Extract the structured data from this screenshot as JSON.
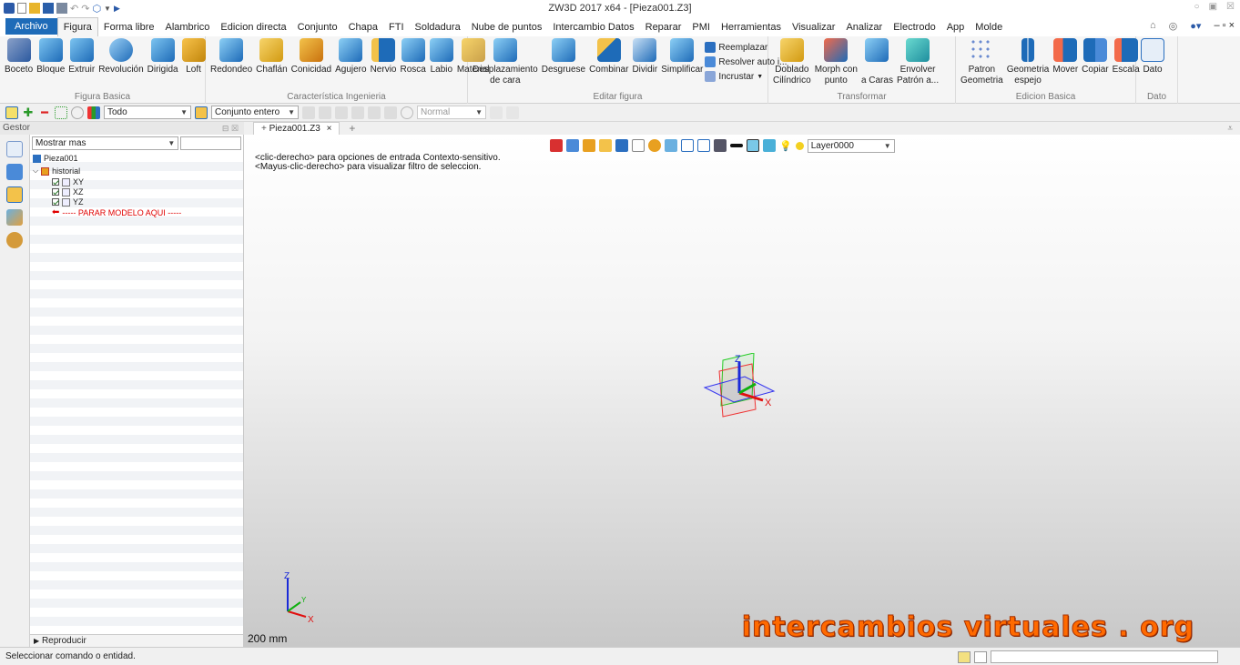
{
  "app": {
    "title": "ZW3D 2017 x64 - [Pieza001.Z3]",
    "accent": "#1e6bb8"
  },
  "menu": {
    "file": "Archivo",
    "tabs": [
      "Figura",
      "Forma libre",
      "Alambrico",
      "Edicion directa",
      "Conjunto",
      "Chapa",
      "FTI",
      "Soldadura",
      "Nube de puntos",
      "Intercambio Datos",
      "Reparar",
      "PMI",
      "Herramientas",
      "Visualizar",
      "Analizar",
      "Electrodo",
      "App",
      "Molde"
    ],
    "active": "Figura"
  },
  "ribbon": {
    "figura_basica": {
      "label": "Figura Basica",
      "buttons": [
        "Boceto",
        "Bloque",
        "Extruir",
        "Revolución",
        "Dirigida",
        "Loft"
      ]
    },
    "caracteristica": {
      "label": "Característica Ingenieria",
      "buttons": [
        "Redondeo",
        "Chaflán",
        "Conicidad",
        "Agujero",
        "Nervio",
        "Rosca",
        "Labio",
        "Material"
      ]
    },
    "editar": {
      "label": "Editar figura",
      "btn_desplazamiento_1": "Desplazamiento",
      "btn_desplazamiento_2": "de cara",
      "buttons": [
        "Desgruese",
        "Combinar",
        "Dividir",
        "Simplificar"
      ],
      "small": [
        "Reemplazar",
        "Resolver auto i...",
        "Incrustar"
      ]
    },
    "transformar": {
      "label": "Transformar",
      "doblado_1": "Doblado",
      "doblado_2": "Cilíndrico",
      "morph_1": "Morph con",
      "morph_2": "punto",
      "acaras": "a Caras",
      "envolver_1": "Envolver",
      "envolver_2": "Patrón a..."
    },
    "edicion_basica": {
      "label": "Edicion Basica",
      "patron_1": "Patron",
      "patron_2": "Geometria",
      "geo_1": "Geometria",
      "geo_2": "espejo",
      "buttons": [
        "Mover",
        "Copiar",
        "Escala"
      ]
    },
    "dato": {
      "label": "Dato",
      "button": "Dato"
    }
  },
  "toolbar": {
    "filter": "Todo",
    "assembly": "Conjunto entero",
    "style": "Normal"
  },
  "gestor": {
    "title": "Gestor",
    "show_more": "Mostrar mas",
    "tree": {
      "root": "Pieza001",
      "history": "historial",
      "planes": [
        "XY",
        "XZ",
        "YZ"
      ],
      "stop": "----- PARAR MODELO AQUI -----"
    },
    "replay": "Reproducir"
  },
  "viewport": {
    "tab": "Pieza001.Z3",
    "hint1": "<clic-derecho> para opciones de entrada Contexto-sensitivo.",
    "hint2": "<Mayus-clic-derecho> para visualizar filtro de seleccion.",
    "layer": "Layer0000",
    "scale": "200 mm",
    "watermark": "intercambios virtuales . org",
    "axes": {
      "x": "X",
      "y": "Y",
      "z": "Z"
    }
  },
  "status": {
    "message": "Seleccionar comando o entidad."
  }
}
